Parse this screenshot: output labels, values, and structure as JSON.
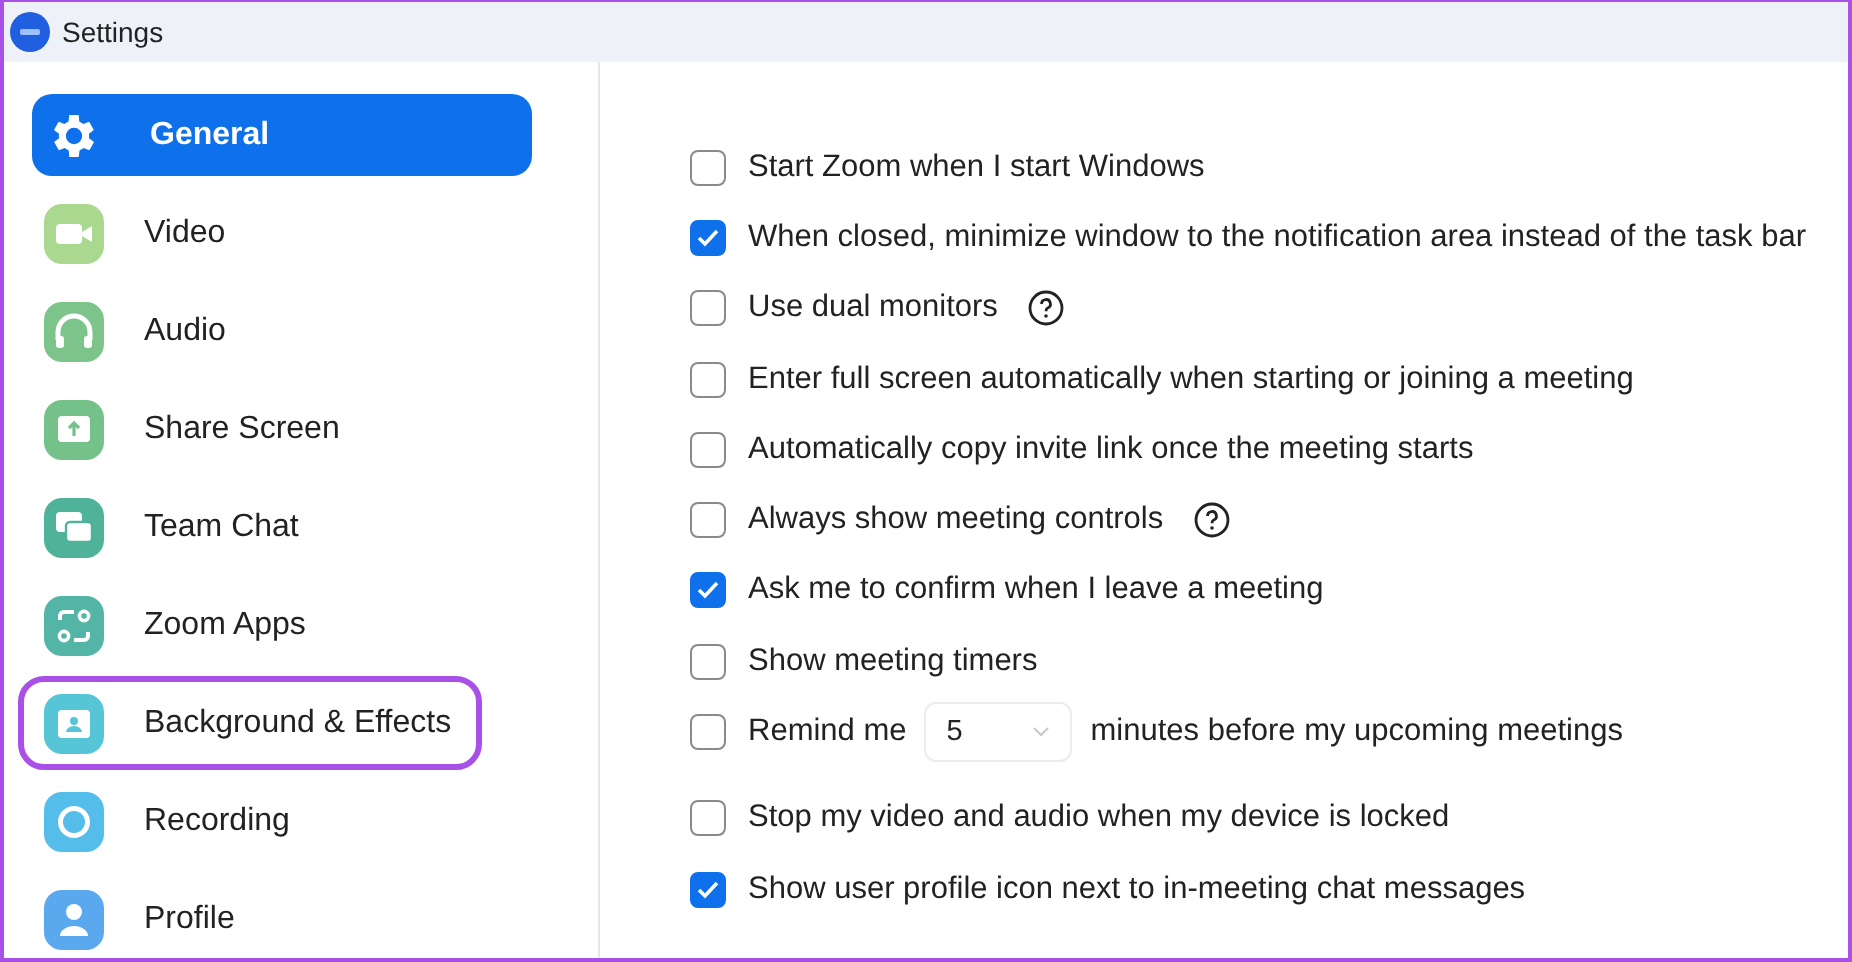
{
  "window": {
    "title": "Settings"
  },
  "sidebar": {
    "items": [
      {
        "label": "General",
        "selected": true,
        "highlighted": false,
        "color": "#ffffff"
      },
      {
        "label": "Video",
        "selected": false,
        "highlighted": false,
        "color": "#a9d88e"
      },
      {
        "label": "Audio",
        "selected": false,
        "highlighted": false,
        "color": "#7dc48b"
      },
      {
        "label": "Share Screen",
        "selected": false,
        "highlighted": false,
        "color": "#74c28a"
      },
      {
        "label": "Team Chat",
        "selected": false,
        "highlighted": false,
        "color": "#4fb39a"
      },
      {
        "label": "Zoom Apps",
        "selected": false,
        "highlighted": false,
        "color": "#52b5a5"
      },
      {
        "label": "Background & Effects",
        "selected": false,
        "highlighted": true,
        "color": "#56c6d6"
      },
      {
        "label": "Recording",
        "selected": false,
        "highlighted": false,
        "color": "#55bde9"
      },
      {
        "label": "Profile",
        "selected": false,
        "highlighted": false,
        "color": "#5aa8ee"
      }
    ]
  },
  "options": [
    {
      "kind": "checkbox",
      "label": "Start Zoom when I start Windows",
      "checked": false,
      "help": false
    },
    {
      "kind": "checkbox",
      "label": "When closed, minimize window to the notification area instead of the task bar",
      "checked": true,
      "help": false
    },
    {
      "kind": "checkbox",
      "label": "Use dual monitors",
      "checked": false,
      "help": true
    },
    {
      "kind": "checkbox",
      "label": "Enter full screen automatically when starting or joining a meeting",
      "checked": false,
      "help": false
    },
    {
      "kind": "checkbox",
      "label": "Automatically copy invite link once the meeting starts",
      "checked": false,
      "help": false
    },
    {
      "kind": "checkbox",
      "label": "Always show meeting controls",
      "checked": false,
      "help": true
    },
    {
      "kind": "checkbox",
      "label": "Ask me to confirm when I leave a meeting",
      "checked": true,
      "help": false
    },
    {
      "kind": "checkbox",
      "label": "Show meeting timers",
      "checked": false,
      "help": false
    },
    {
      "kind": "reminder",
      "label": "Remind me",
      "value": "5",
      "suffix": "minutes before my upcoming meetings",
      "checked": false,
      "help": false
    },
    {
      "kind": "checkbox",
      "label": "Stop my video and audio when my device is locked",
      "checked": false,
      "help": false
    },
    {
      "kind": "checkbox",
      "label": "Show user profile icon next to in-meeting chat messages",
      "checked": true,
      "help": false
    }
  ]
}
